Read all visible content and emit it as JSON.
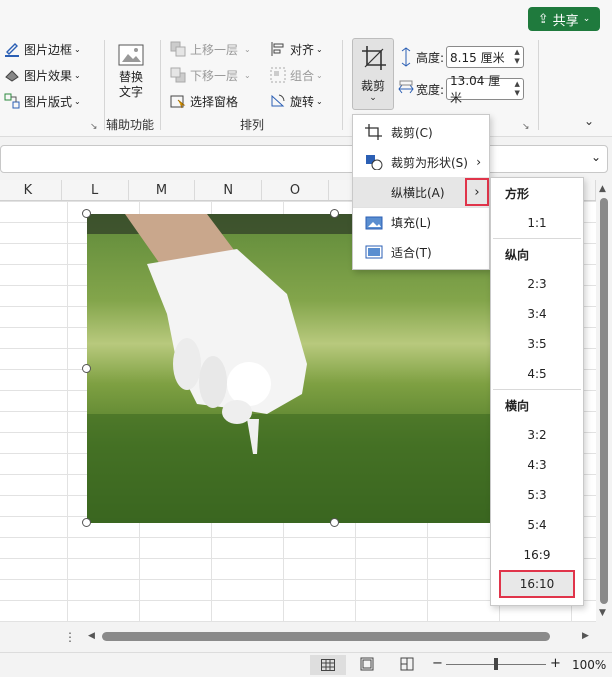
{
  "share": {
    "label": "共享"
  },
  "ribbon": {
    "picture_group": {
      "border": "图片边框",
      "effects": "图片效果",
      "layout": "图片版式"
    },
    "accessibility_group": {
      "alt_text_line1": "替换",
      "alt_text_line2": "文字",
      "label": "辅助功能"
    },
    "arrange_group": {
      "bring_forward": "上移一层",
      "send_backward": "下移一层",
      "selection_pane": "选择窗格",
      "align": "对齐",
      "group": "组合",
      "rotate": "旋转",
      "label": "排列"
    },
    "crop": {
      "label": "裁剪"
    },
    "size_group": {
      "height_label": "高度:",
      "height_value": "8.15 厘米",
      "width_label": "宽度:",
      "width_value": "13.04 厘米"
    }
  },
  "columns": [
    "K",
    "L",
    "M",
    "N",
    "O"
  ],
  "crop_menu": {
    "items": [
      {
        "label": "裁剪(C)",
        "icon": "crop-icon"
      },
      {
        "label": "裁剪为形状(S)",
        "icon": "crop-to-shape-icon",
        "has_submenu": true
      },
      {
        "label": "纵横比(A)",
        "icon": "",
        "has_submenu": true,
        "active": true
      },
      {
        "label": "填充(L)",
        "icon": "fill-icon"
      },
      {
        "label": "适合(T)",
        "icon": "fit-icon"
      }
    ]
  },
  "aspect_submenu": {
    "square_header": "方形",
    "square": [
      "1:1"
    ],
    "portrait_header": "纵向",
    "portrait": [
      "2:3",
      "3:4",
      "3:5",
      "4:5"
    ],
    "landscape_header": "横向",
    "landscape": [
      "3:2",
      "4:3",
      "5:3",
      "5:4",
      "16:9",
      "16:10"
    ],
    "highlighted": "16:10"
  },
  "status": {
    "zoom": "100%"
  },
  "colors": {
    "accent_green": "#1f7a3d",
    "highlight_red": "#e0344a"
  }
}
